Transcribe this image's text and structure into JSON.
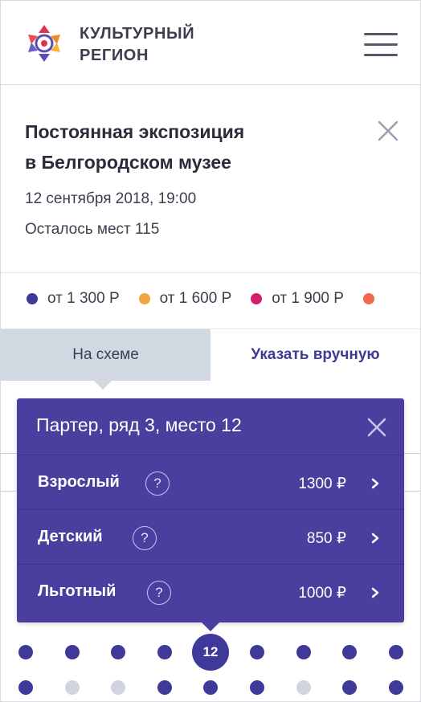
{
  "header": {
    "brand_line1": "КУЛЬТУРНЫЙ",
    "brand_line2": "РЕГИОН",
    "menu_icon": "hamburger-menu-icon",
    "logo_icon": "flower-logo-icon"
  },
  "event": {
    "title_line1": "Постоянная экспозиция",
    "title_line2": "в Белгородском музее",
    "datetime": "12 сентября 2018, 19:00",
    "seats_left": "Осталось мест 115",
    "close_icon": "close-icon"
  },
  "prices": [
    {
      "label": "от 1 300 Р",
      "color": "#3f399a"
    },
    {
      "label": "от 1 600 Р",
      "color": "#f0a640"
    },
    {
      "label": "от 1 900 Р",
      "color": "#d41e6b"
    },
    {
      "label": "",
      "color": "#f16a4f"
    }
  ],
  "tabs": {
    "scheme": "На схеме",
    "manual": "Указать вручную",
    "active": "scheme"
  },
  "popup": {
    "title": "Партер, ряд 3, место 12",
    "close_icon": "close-icon",
    "help_icon": "question-circle-icon",
    "help_glyph": "?",
    "chevron_icon": "chevron-right-icon",
    "tickets": [
      {
        "name": "Взрослый",
        "price": "1300 ₽"
      },
      {
        "name": "Детский",
        "price": "850 ₽"
      },
      {
        "name": "Льготный",
        "price": "1000 ₽"
      }
    ]
  },
  "seats": {
    "selected_number": "12",
    "row1_available": [
      true,
      true,
      true,
      true,
      "selected",
      true,
      true,
      true,
      true
    ],
    "row2_available": [
      true,
      false,
      false,
      true,
      true,
      true,
      false,
      true,
      true
    ]
  },
  "colors": {
    "accent": "#4a3f9f",
    "seat": "#3f399a",
    "seat_unavailable": "#d0d4e0",
    "tab_active_bg": "#d2d8e2"
  }
}
